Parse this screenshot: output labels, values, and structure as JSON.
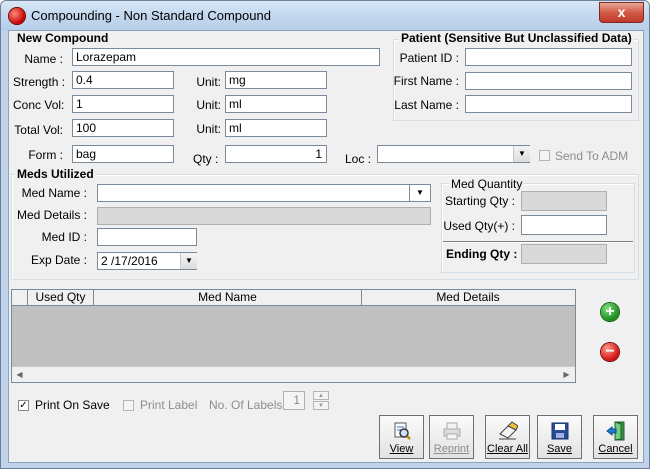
{
  "window": {
    "title": "Compounding  - Non Standard Compound",
    "close_label": "x"
  },
  "new_compound": {
    "legend": "New Compound",
    "name_label": "Name :",
    "name_value": "Lorazepam",
    "strength_label": "Strength :",
    "strength_value": "0.4",
    "conc_label": "Conc Vol:",
    "conc_value": "1",
    "total_label": "Total Vol:",
    "total_value": "100",
    "form_label": "Form :",
    "form_value": "bag",
    "unit_label": "Unit:",
    "unit1_value": "mg",
    "unit2_value": "ml",
    "unit3_value": "ml",
    "qty_label": "Qty :",
    "qty_value": "1",
    "loc_label": "Loc :",
    "loc_value": "",
    "send_to_adm_label": "Send To ADM",
    "send_to_adm_checked": false
  },
  "patient": {
    "legend": "Patient (Sensitive But Unclassified Data)",
    "patient_id_label": "Patient ID :",
    "patient_id_value": "",
    "first_name_label": "First Name :",
    "first_name_value": "",
    "last_name_label": "Last Name :",
    "last_name_value": ""
  },
  "meds": {
    "legend": "Meds Utilized",
    "med_name_label": "Med Name :",
    "med_name_value": "",
    "med_details_label": "Med Details :",
    "med_details_value": "",
    "med_id_label": "Med ID :",
    "med_id_value": "",
    "exp_date_label": "Exp Date :",
    "exp_date_value": "2 /17/2016"
  },
  "med_quantity": {
    "legend": "Med Quantity",
    "starting_label": "Starting Qty :",
    "starting_value": "",
    "used_label": "Used Qty(+) :",
    "used_value": "",
    "ending_label": "Ending Qty :",
    "ending_value": ""
  },
  "grid": {
    "columns": [
      "Used Qty",
      "Med Name",
      "Med Details"
    ],
    "rows": []
  },
  "options": {
    "print_on_save_label": "Print On Save",
    "print_on_save_checked": true,
    "print_label_label": "Print Label",
    "print_label_checked": false,
    "no_of_labels_label": "No. Of Labels :",
    "no_of_labels_value": "1"
  },
  "toolbar": {
    "view": "View",
    "reprint": "Reprint",
    "clear_all": "Clear All",
    "save": "Save",
    "cancel": "Cancel"
  },
  "icons": {
    "app": "app-icon",
    "add": "plus-circle-icon",
    "remove": "minus-circle-icon",
    "view": "view-icon",
    "reprint": "printer-icon",
    "clear_all": "eraser-icon",
    "save": "floppy-disk-icon",
    "cancel": "exit-door-icon"
  },
  "colors": {
    "title_bar": "#c3d7ee",
    "close_button": "#c0392b",
    "dialog_bg": "#f0f0f0",
    "grid_bg": "#c0c0c0",
    "add_green": "#1d8a1d",
    "remove_red": "#d01010"
  }
}
